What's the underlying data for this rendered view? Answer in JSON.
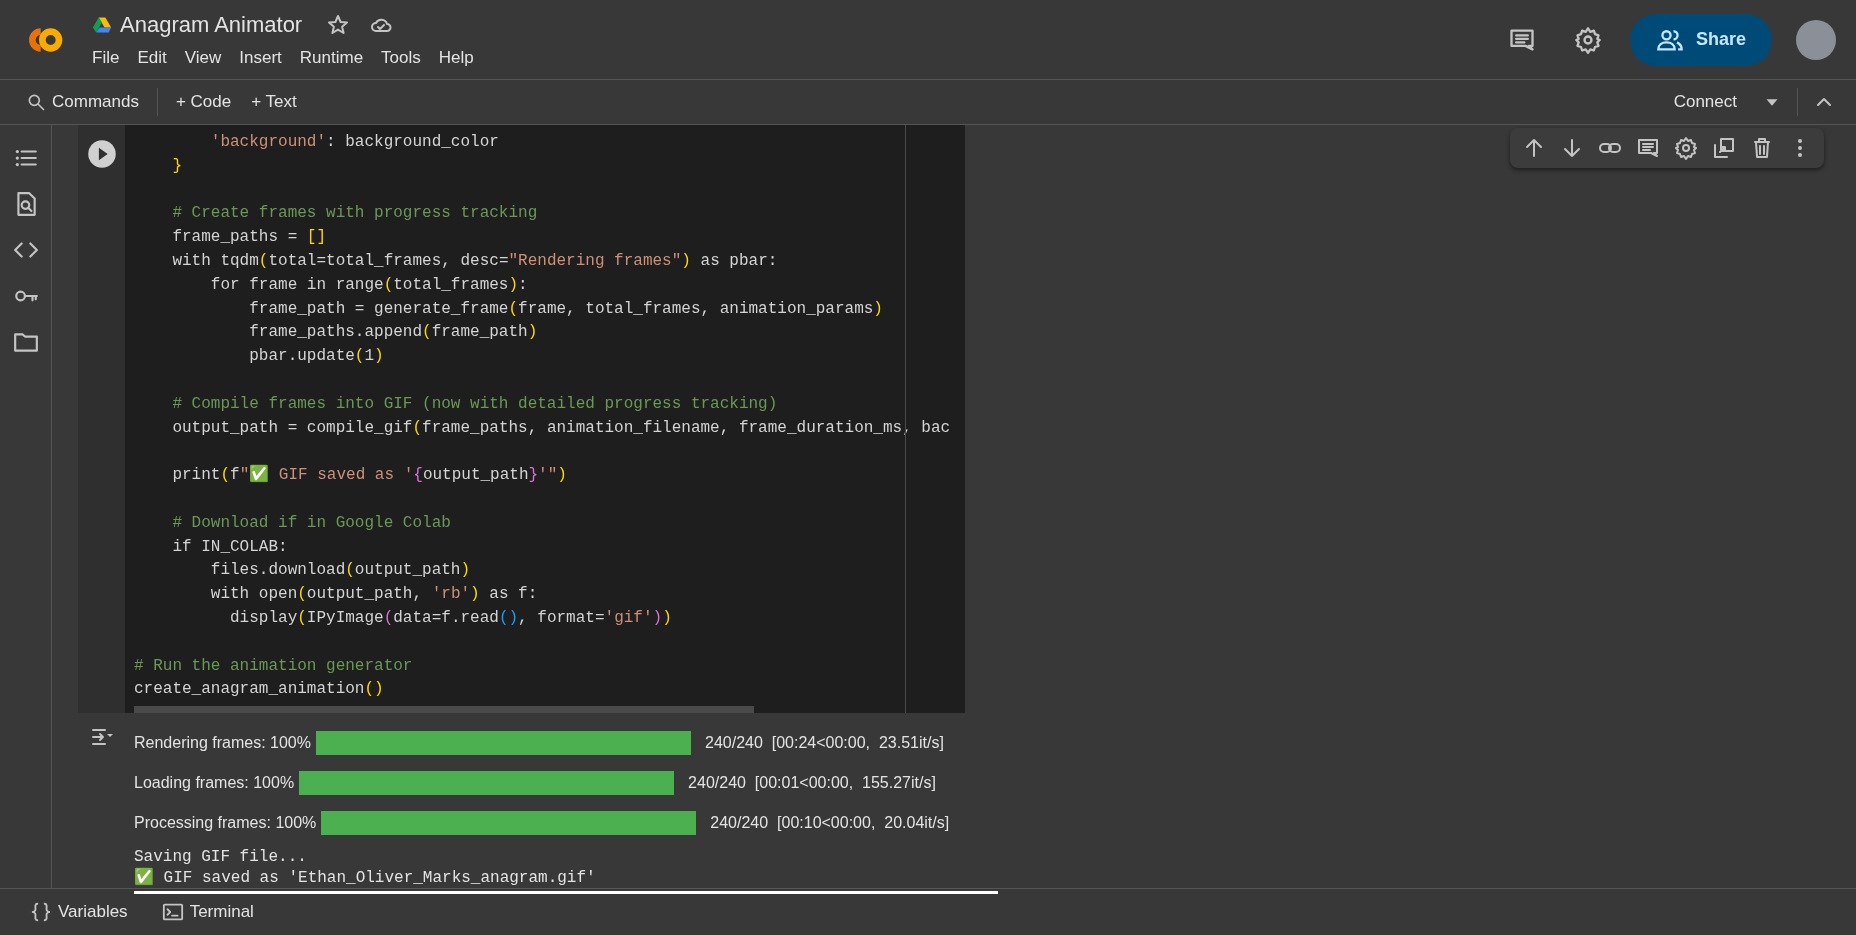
{
  "header": {
    "title": "Anagram Animator",
    "menus": [
      "File",
      "Edit",
      "View",
      "Insert",
      "Runtime",
      "Tools",
      "Help"
    ],
    "share_label": "Share"
  },
  "toolbar": {
    "commands_label": "Commands",
    "add_code_label": "+ Code",
    "add_text_label": "+ Text",
    "connect_label": "Connect"
  },
  "code": "        'background': background_color\n    }\n\n    # Create frames with progress tracking\n    frame_paths = []\n    with tqdm(total=total_frames, desc=\"Rendering frames\") as pbar:\n        for frame in range(total_frames):\n            frame_path = generate_frame(frame, total_frames, animation_params)\n            frame_paths.append(frame_path)\n            pbar.update(1)\n\n    # Compile frames into GIF (now with detailed progress tracking)\n    output_path = compile_gif(frame_paths, animation_filename, frame_duration_ms, bac\n\n    print(f\"✅ GIF saved as '{output_path}'\")\n\n    # Download if in Google Colab\n    if IN_COLAB:\n        files.download(output_path)\n        with open(output_path, 'rb') as f:\n          display(IPyImage(data=f.read(), format='gif'))\n\n# Run the animation generator\ncreate_anagram_animation()",
  "output": {
    "progress_bars": [
      {
        "label": "Rendering frames: 100%",
        "level": 1,
        "stats": "240/240  [00:24<00:00,  23.51it/s]"
      },
      {
        "label": "Loading frames: 100%",
        "level": 1,
        "stats": "240/240  [00:01<00:00,  155.27it/s]"
      },
      {
        "label": "Processing frames: 100%",
        "level": 1,
        "stats": "240/240  [00:10<00:00,  20.04it/s]"
      }
    ],
    "lines": [
      "Saving GIF file...",
      "✅ GIF saved as 'Ethan_Oliver_Marks_anagram.gif'"
    ]
  },
  "bottom_bar": {
    "variables_label": "Variables",
    "terminal_label": "Terminal"
  }
}
